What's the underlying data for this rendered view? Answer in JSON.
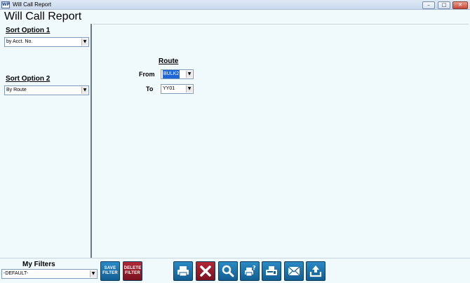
{
  "window": {
    "title": "Will Call Report",
    "app_icon_text": "WP",
    "controls": {
      "minimize": "–",
      "maximize": "□",
      "close": "✕"
    }
  },
  "header": {
    "title": "Will Call Report"
  },
  "sort_option_1": {
    "label": "Sort Option 1",
    "selected": "by Acct. No."
  },
  "sort_option_2": {
    "label": "Sort Option 2",
    "selected": "By Route"
  },
  "route": {
    "title": "Route",
    "from_label": "From",
    "from_value": "BULK2",
    "to_label": "To",
    "to_value": "YY01"
  },
  "filters": {
    "label": "My Filters",
    "selected": "-DEFAULT-"
  },
  "toolbar": {
    "save_filter_line1": "SAVE",
    "save_filter_line2": "FILTER",
    "delete_filter_line1": "DELETE",
    "delete_filter_line2": "FILTER",
    "icons": [
      "printer-icon",
      "cancel-x-icon",
      "search-icon",
      "print-preview-icon",
      "fax-icon",
      "email-icon",
      "export-icon"
    ]
  },
  "colors": {
    "background": "#f0fafc",
    "button_blue": "#1e74ab",
    "button_red": "#9a1c2a",
    "selection": "#1f66d6"
  }
}
